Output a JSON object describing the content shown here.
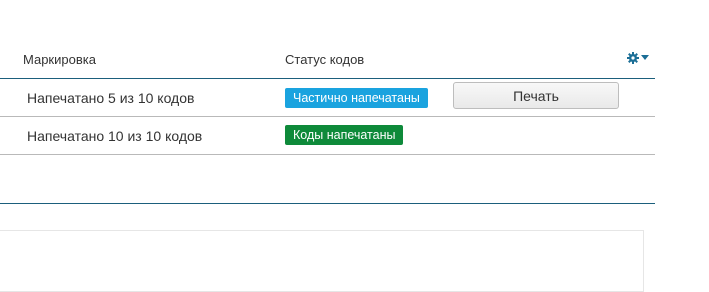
{
  "table": {
    "headers": {
      "marking": "Маркировка",
      "codes_status": "Статус кодов"
    },
    "settings_icon": "gear-icon",
    "rows": [
      {
        "marking": "Напечатано 5 из 10 кодов",
        "status": "Частично напечатаны",
        "status_color": "#1aa3df",
        "action": "Печать"
      },
      {
        "marking": "Напечатано 10 из 10 кодов",
        "status": "Коды напечатаны",
        "status_color": "#0e8a3a"
      }
    ]
  },
  "colors": {
    "accent_line": "#1b5f7c",
    "row_border": "#b9b9b9"
  }
}
